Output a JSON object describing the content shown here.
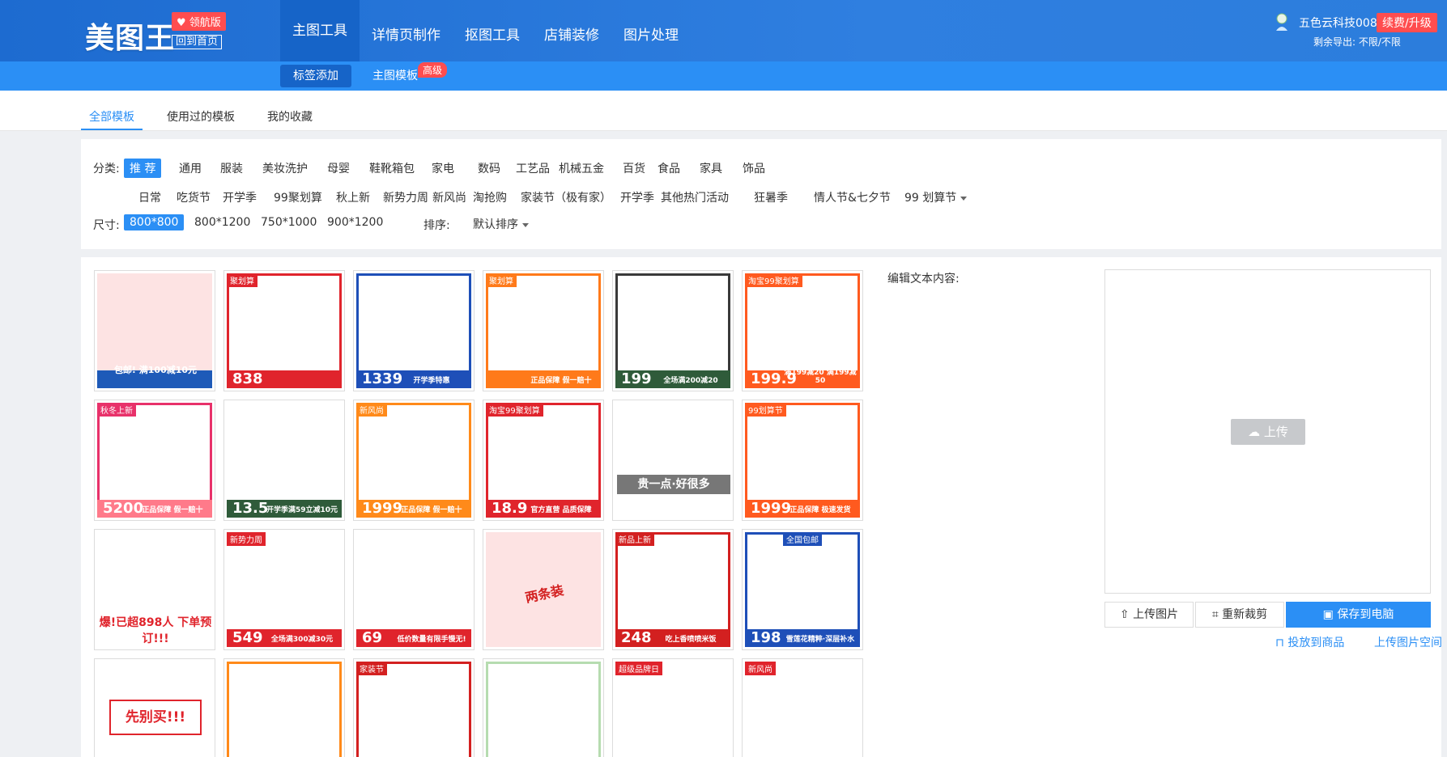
{
  "header": {
    "logo": "美图王",
    "vip_badge": "领航版",
    "home_link": "回到首页",
    "nav": [
      "主图工具",
      "详情页制作",
      "抠图工具",
      "店铺装修",
      "图片处理"
    ],
    "sub_nav": [
      "标签添加",
      "主图模板"
    ],
    "hot_tag": "高级",
    "user_name": "五色云科技008",
    "renew": "续费/升级",
    "quota": "剩余导出: 不限/不限"
  },
  "tabs": [
    "全部模板",
    "使用过的模板",
    "我的收藏"
  ],
  "filter": {
    "category_label": "分类:",
    "row1": [
      "推 荐",
      "通用",
      "服装",
      "美妆洗护",
      "母婴",
      "鞋靴箱包",
      "家电",
      "数码",
      "工艺品",
      "机械五金",
      "百货",
      "食品",
      "家具",
      "饰品"
    ],
    "row2": [
      "日常",
      "吃货节",
      "开学季",
      "99聚划算",
      "秋上新",
      "新势力周",
      "新风尚",
      "淘抢购",
      "家装节（极有家）",
      "开学季",
      "其他热门活动",
      "狂暑季",
      "情人节&七夕节",
      "99 划算节"
    ],
    "size_label": "尺寸:",
    "sizes": [
      "800*800",
      "800*1200",
      "750*1000",
      "900*1200"
    ],
    "sort_label": "排序:",
    "sort_value": "默认排序"
  },
  "templates": [
    {
      "tag": "",
      "text": "包邮! 满100减10元",
      "price": ""
    },
    {
      "tag": "聚划算",
      "text": "",
      "price": "838"
    },
    {
      "tag": "",
      "text": "开学季特惠",
      "price": "1339"
    },
    {
      "tag": "聚划算",
      "text": "正品保障 假一赔十",
      "price": ""
    },
    {
      "tag": "",
      "text": "全场满200减20",
      "price": "199"
    },
    {
      "tag": "淘宝99聚划算",
      "text": "满199减20 满199减50",
      "price": "199.9"
    },
    {
      "tag": "秋冬上新",
      "text": "正品保障 假一赔十",
      "price": "5200"
    },
    {
      "tag": "",
      "text": "开学季满59立减10元",
      "price": "13.5"
    },
    {
      "tag": "新风尚",
      "text": "正品保障 假一赔十",
      "price": "1999"
    },
    {
      "tag": "淘宝99聚划算",
      "text": "官方直营 品质保障",
      "price": "18.9"
    },
    {
      "tag": "",
      "text": "贵一点·好很多",
      "price": ""
    },
    {
      "tag": "99划算节",
      "text": "正品保障 极速发货",
      "price": "1999"
    },
    {
      "tag": "",
      "text": "爆!已超898人 下单预订!!!",
      "price": ""
    },
    {
      "tag": "新势力周",
      "text": "全场满300减30元",
      "price": "549"
    },
    {
      "tag": "",
      "text": "低价数量有限手慢无!",
      "price": "69"
    },
    {
      "tag": "",
      "text": "两条装",
      "price": ""
    },
    {
      "tag": "新品上新",
      "text": "吃上香喷喷米饭",
      "price": "248"
    },
    {
      "tag": "全国包邮",
      "text": "雪莲花精粹·深层补水",
      "price": "198"
    },
    {
      "tag": "",
      "text": "先别买!!!",
      "price": ""
    },
    {
      "tag": "",
      "text": "",
      "price": ""
    },
    {
      "tag": "家装节",
      "text": "",
      "price": ""
    },
    {
      "tag": "",
      "text": "",
      "price": ""
    },
    {
      "tag": "超级品牌日",
      "text": "",
      "price": ""
    },
    {
      "tag": "新风尚",
      "text": "",
      "price": ""
    }
  ],
  "editor": {
    "label": "编辑文本内容:",
    "upload": "上传",
    "buttons": [
      "上传图片",
      "重新裁剪",
      "保存到电脑"
    ],
    "links": [
      "投放到商品",
      "上传图片空间"
    ]
  },
  "colors": {
    "primary": "#2b8ff5",
    "header": "#1d6bd0",
    "danger": "#ff4d4f"
  }
}
